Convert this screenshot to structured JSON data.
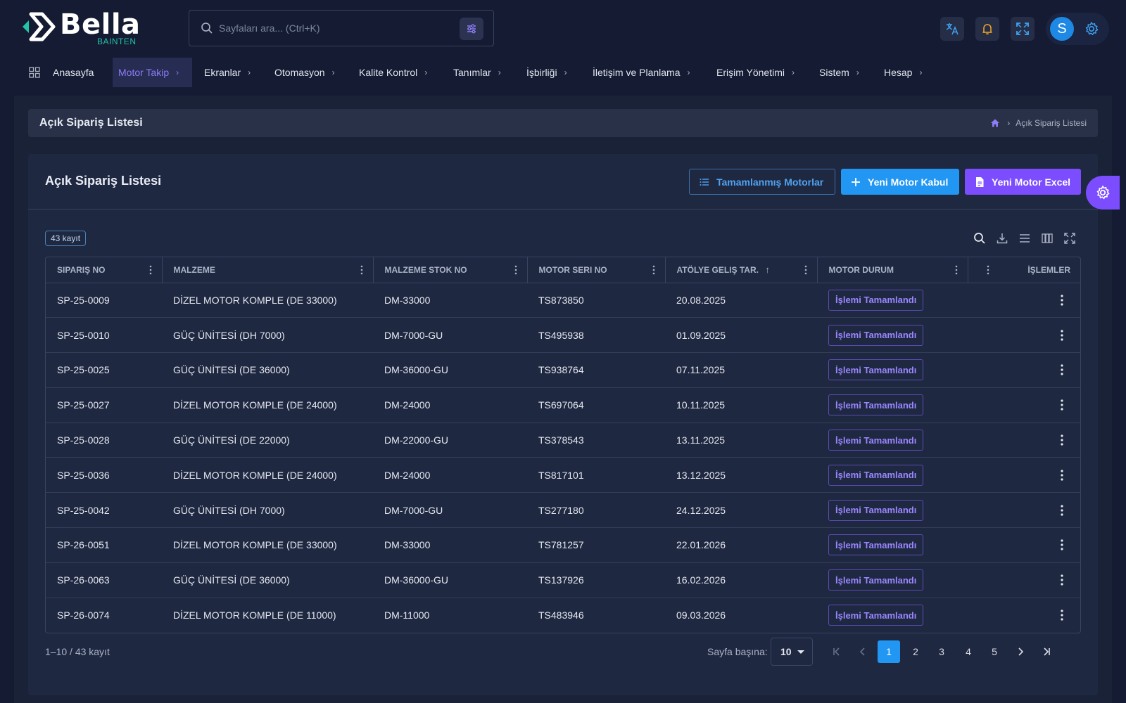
{
  "brand": {
    "name": "Bella",
    "sub": "BAINTEN"
  },
  "search": {
    "placeholder": "Sayfaları ara... (Ctrl+K)"
  },
  "user": {
    "initial": "S"
  },
  "nav": [
    {
      "label": "Anasayfa",
      "icon": "dashboard-icon"
    },
    {
      "label": "Motor Takip",
      "active": true
    },
    {
      "label": "Ekranlar"
    },
    {
      "label": "Otomasyon"
    },
    {
      "label": "Kalite Kontrol"
    },
    {
      "label": "Tanımlar"
    },
    {
      "label": "İşbirliği"
    },
    {
      "label": "İletişim ve Planlama"
    },
    {
      "label": "Erişim Yönetimi"
    },
    {
      "label": "Sistem"
    },
    {
      "label": "Hesap"
    }
  ],
  "page": {
    "title": "Açık Sipariş Listesi",
    "breadcrumb": "Açık Sipariş Listesi"
  },
  "card": {
    "title": "Açık Sipariş Listesi",
    "buttons": {
      "completed": "Tamamlanmış Motorlar",
      "new_motor": "Yeni Motor Kabul",
      "new_excel": "Yeni Motor Excel"
    },
    "count_badge": "43 kayıt"
  },
  "table": {
    "columns": [
      "Sipariş No",
      "Malzeme",
      "Malzeme Stok No",
      "Motor Seri No",
      "Atölye Geliş Tar.",
      "Motor Durum",
      "İşlemler"
    ],
    "rows": [
      {
        "no": "SP-25-0009",
        "malzeme": "DİZEL MOTOR KOMPLE (DE 33000)",
        "stok": "DM-33000",
        "seri": "TS873850",
        "tarih": "20.08.2025",
        "durum": "İşlemi Tamamlandı"
      },
      {
        "no": "SP-25-0010",
        "malzeme": "GÜÇ ÜNİTESİ (DH 7000)",
        "stok": "DM-7000-GU",
        "seri": "TS495938",
        "tarih": "01.09.2025",
        "durum": "İşlemi Tamamlandı"
      },
      {
        "no": "SP-25-0025",
        "malzeme": "GÜÇ ÜNİTESİ (DE 36000)",
        "stok": "DM-36000-GU",
        "seri": "TS938764",
        "tarih": "07.11.2025",
        "durum": "İşlemi Tamamlandı"
      },
      {
        "no": "SP-25-0027",
        "malzeme": "DİZEL MOTOR KOMPLE (DE 24000)",
        "stok": "DM-24000",
        "seri": "TS697064",
        "tarih": "10.11.2025",
        "durum": "İşlemi Tamamlandı"
      },
      {
        "no": "SP-25-0028",
        "malzeme": "GÜÇ ÜNİTESİ (DE 22000)",
        "stok": "DM-22000-GU",
        "seri": "TS378543",
        "tarih": "13.11.2025",
        "durum": "İşlemi Tamamlandı"
      },
      {
        "no": "SP-25-0036",
        "malzeme": "DİZEL MOTOR KOMPLE (DE 24000)",
        "stok": "DM-24000",
        "seri": "TS817101",
        "tarih": "13.12.2025",
        "durum": "İşlemi Tamamlandı"
      },
      {
        "no": "SP-25-0042",
        "malzeme": "GÜÇ ÜNİTESİ (DH 7000)",
        "stok": "DM-7000-GU",
        "seri": "TS277180",
        "tarih": "24.12.2025",
        "durum": "İşlemi Tamamlandı"
      },
      {
        "no": "SP-26-0051",
        "malzeme": "DİZEL MOTOR KOMPLE (DE 33000)",
        "stok": "DM-33000",
        "seri": "TS781257",
        "tarih": "22.01.2026",
        "durum": "İşlemi Tamamlandı"
      },
      {
        "no": "SP-26-0063",
        "malzeme": "GÜÇ ÜNİTESİ (DE 36000)",
        "stok": "DM-36000-GU",
        "seri": "TS137926",
        "tarih": "16.02.2026",
        "durum": "İşlemi Tamamlandı"
      },
      {
        "no": "SP-26-0074",
        "malzeme": "DİZEL MOTOR KOMPLE (DE 11000)",
        "stok": "DM-11000",
        "seri": "TS483946",
        "tarih": "09.03.2026",
        "durum": "İşlemi Tamamlandı"
      }
    ]
  },
  "pagination": {
    "info": "1–10 / 43 kayıt",
    "per_page_label": "Sayfa başına:",
    "per_page_value": "10",
    "pages": [
      "1",
      "2",
      "3",
      "4",
      "5"
    ],
    "current": "1"
  },
  "colors": {
    "accent_purple": "#7c4dff",
    "accent_blue": "#2196f3",
    "brand_teal": "#22c3a6",
    "background": "#141b32"
  }
}
